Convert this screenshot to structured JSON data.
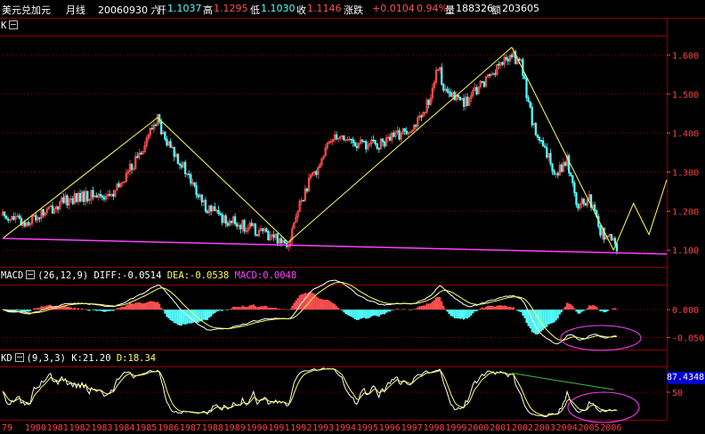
{
  "header": {
    "symbol": "美元兑加元",
    "period": "月线",
    "date": "20060930 六",
    "open_label": "开",
    "open": "1.1037",
    "high_label": "高",
    "high": "1.1295",
    "low_label": "低",
    "low": "1.1030",
    "close_label": "收",
    "close": "1.1146",
    "change_label": "涨跌",
    "change": "+0.0104",
    "change_pct": "0.94%",
    "volume_label": "量",
    "volume": "188326",
    "amount_label": "额",
    "amount": "203605"
  },
  "colors": {
    "up": "#ff5050",
    "down": "#54ffff",
    "grid": "#900000",
    "axis_text": "#ff4040",
    "trendline": "#ffff60",
    "support": "#ff40ff",
    "ellipse": "#ff40ff",
    "kd_trend": "#40c040",
    "white": "#ffffff"
  },
  "panels": {
    "price": {
      "name": "K"
    },
    "macd": {
      "name": "MACD",
      "params": "(26,12,9)",
      "diff_label": "DIFF:",
      "diff": "-0.0514",
      "dea_label": "DEA:",
      "dea": "-0.0538",
      "macd_label": "MACD:",
      "macd": "0.0048"
    },
    "kd": {
      "name": "KD",
      "params": "(9,3,3)",
      "k_label": "K:",
      "k": "21.20",
      "d_label": "D:",
      "d": "18.34",
      "badge": "87.4348"
    }
  },
  "chart_data": [
    {
      "type": "candlestick",
      "panel": "price",
      "x_labels": [
        "1979",
        "1980",
        "1981",
        "1982",
        "1983",
        "1984",
        "1985",
        "1986",
        "1987",
        "1988",
        "1989",
        "1990",
        "1991",
        "1992",
        "1993",
        "1994",
        "1995",
        "1996",
        "1997",
        "1998",
        "1999",
        "2000",
        "2001",
        "2002",
        "2003",
        "2004",
        "2005",
        "2006"
      ],
      "x_tick_text": [
        "79",
        "1980",
        "1981",
        "1982",
        "1983",
        "1984",
        "1985",
        "1986",
        "1987",
        "1988",
        "1989",
        "1990",
        "1991",
        "1992",
        "1993",
        "1994",
        "1995",
        "1996",
        "1997",
        "1998",
        "1999",
        "2000",
        "2001",
        "2002",
        "2003",
        "2004",
        "2005",
        "2006"
      ],
      "y_ticks": [
        "1.100",
        "1.200",
        "1.300",
        "1.400",
        "1.500",
        "1.600"
      ],
      "ylim": [
        1.08,
        1.65
      ],
      "anchors_year_close": [
        [
          1979.0,
          1.19
        ],
        [
          1980.0,
          1.17
        ],
        [
          1981.0,
          1.2
        ],
        [
          1982.0,
          1.23
        ],
        [
          1983.0,
          1.24
        ],
        [
          1984.0,
          1.24
        ],
        [
          1985.0,
          1.33
        ],
        [
          1986.0,
          1.44
        ],
        [
          1986.3,
          1.38
        ],
        [
          1987.0,
          1.33
        ],
        [
          1988.0,
          1.22
        ],
        [
          1989.0,
          1.18
        ],
        [
          1990.0,
          1.16
        ],
        [
          1991.0,
          1.14
        ],
        [
          1991.9,
          1.12
        ],
        [
          1992.5,
          1.23
        ],
        [
          1993.0,
          1.29
        ],
        [
          1994.0,
          1.4
        ],
        [
          1995.0,
          1.37
        ],
        [
          1996.0,
          1.37
        ],
        [
          1997.0,
          1.4
        ],
        [
          1998.0,
          1.44
        ],
        [
          1998.7,
          1.57
        ],
        [
          1999.0,
          1.5
        ],
        [
          2000.0,
          1.48
        ],
        [
          2001.0,
          1.55
        ],
        [
          2002.0,
          1.6
        ],
        [
          2002.4,
          1.58
        ],
        [
          2003.0,
          1.41
        ],
        [
          2003.5,
          1.35
        ],
        [
          2004.0,
          1.3
        ],
        [
          2004.5,
          1.33
        ],
        [
          2005.0,
          1.21
        ],
        [
          2005.5,
          1.23
        ],
        [
          2006.0,
          1.15
        ],
        [
          2006.7,
          1.11
        ]
      ],
      "trendlines": [
        [
          [
            1979.0,
            1.13
          ],
          [
            1986.0,
            1.44
          ]
        ],
        [
          [
            1986.0,
            1.44
          ],
          [
            1991.9,
            1.12
          ]
        ],
        [
          [
            1991.9,
            1.12
          ],
          [
            2002.0,
            1.62
          ]
        ],
        [
          [
            2002.0,
            1.62
          ],
          [
            2006.6,
            1.1
          ]
        ]
      ],
      "projection": [
        [
          2006.6,
          1.1
        ],
        [
          2007.5,
          1.22
        ],
        [
          2008.2,
          1.14
        ],
        [
          2009.0,
          1.28
        ]
      ],
      "support_line": [
        [
          1979.0,
          1.13
        ],
        [
          2009.0,
          1.09
        ]
      ]
    },
    {
      "type": "bar",
      "panel": "macd",
      "series": [
        {
          "name": "DIFF"
        },
        {
          "name": "DEA"
        },
        {
          "name": "MACD"
        }
      ],
      "y_ticks": [
        "0.000",
        "-0.050"
      ],
      "ylim": [
        -0.07,
        0.045
      ],
      "last_values": {
        "DIFF": -0.0514,
        "DEA": -0.0538,
        "MACD": 0.0048
      }
    },
    {
      "type": "line",
      "panel": "kd",
      "series": [
        {
          "name": "K"
        },
        {
          "name": "D"
        }
      ],
      "y_ticks": [
        "50"
      ],
      "ylim": [
        0,
        100
      ],
      "last_values": {
        "K": 21.2,
        "D": 18.34
      },
      "trend_segment": [
        [
          2002.0,
          87
        ],
        [
          2006.6,
          55
        ]
      ]
    }
  ]
}
